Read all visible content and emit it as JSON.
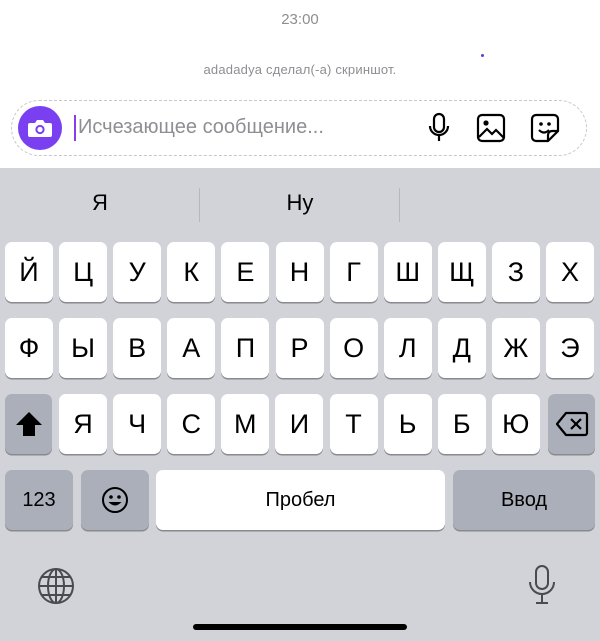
{
  "chat": {
    "time": "23:00",
    "system_message": "adadadya сделал(-а) скриншот."
  },
  "composer": {
    "placeholder": "Исчезающее сообщение...",
    "icons": [
      "camera-icon",
      "microphone-icon",
      "gallery-icon",
      "sticker-icon"
    ],
    "accent_color": "#7b3ff2"
  },
  "keyboard": {
    "suggestions": [
      "Я",
      "Ну",
      ""
    ],
    "row1": [
      "Й",
      "Ц",
      "У",
      "К",
      "Е",
      "Н",
      "Г",
      "Ш",
      "Щ",
      "З",
      "Х"
    ],
    "row2": [
      "Ф",
      "Ы",
      "В",
      "А",
      "П",
      "Р",
      "О",
      "Л",
      "Д",
      "Ж",
      "Э"
    ],
    "row3": [
      "Я",
      "Ч",
      "С",
      "М",
      "И",
      "Т",
      "Ь",
      "Б",
      "Ю"
    ],
    "numbers_label": "123",
    "space_label": "Пробел",
    "return_label": "Ввод"
  }
}
